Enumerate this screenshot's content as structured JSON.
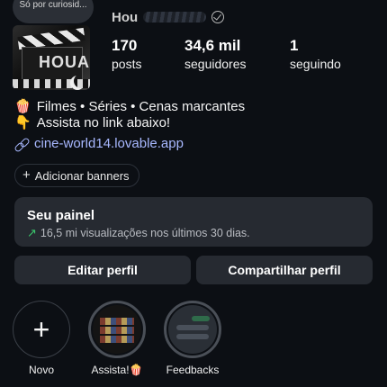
{
  "profile": {
    "note": "Só por curiosid...",
    "username": "Hou",
    "avatar_text": "HOUA",
    "stats": [
      {
        "key": "posts",
        "value": "170",
        "label": "posts"
      },
      {
        "key": "followers",
        "value": "34,6 mil",
        "label": "seguidores"
      },
      {
        "key": "following",
        "value": "1",
        "label": "seguindo"
      }
    ],
    "bio": {
      "line1_emoji": "🍿",
      "line1": "Filmes • Séries • Cenas marcantes",
      "line2_emoji": "👇",
      "line2": "Assista no link abaixo!"
    },
    "link": "cine-world14.lovable.app",
    "add_banners_label": "Adicionar banners"
  },
  "dashboard": {
    "title": "Seu painel",
    "subtitle": "16,5 mi visualizações nos últimos 30 dias."
  },
  "actions": {
    "edit_label": "Editar perfil",
    "share_label": "Compartilhar perfil"
  },
  "highlights": [
    {
      "label": "Novo"
    },
    {
      "label": "Assista!🍿"
    },
    {
      "label": "Feedbacks"
    }
  ],
  "colors": {
    "background": "#0c0f14",
    "card": "#262a31",
    "link": "#a8b8ff",
    "trend": "#3ac56b"
  }
}
